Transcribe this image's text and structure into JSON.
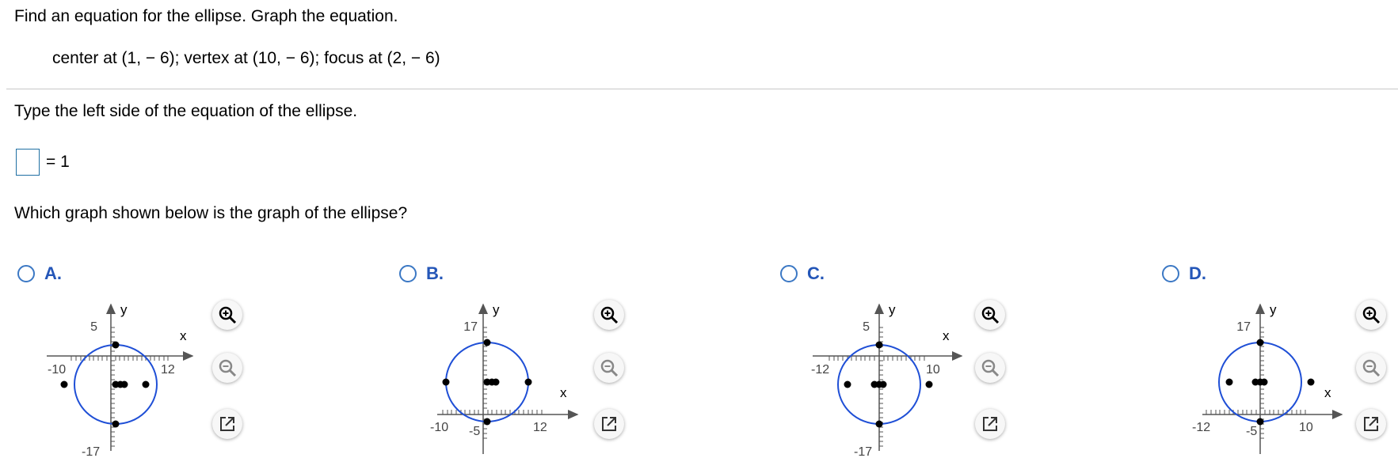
{
  "problem": {
    "prompt": "Find an equation for the ellipse.  Graph the equation.",
    "given": "center at (1, − 6);  vertex at (10, − 6);  focus at (2, − 6)",
    "instruction": "Type the left side of the equation of the ellipse.",
    "answer_value": "",
    "equals_text": "= 1",
    "graph_question": "Which graph shown below is the graph of the ellipse?"
  },
  "options": [
    {
      "letter": "A.",
      "xlabel": "x",
      "ylabel": "y",
      "tick_x_left": "-10",
      "tick_x_right": "12",
      "tick_y_top": "5",
      "tick_y_bottom": "-17"
    },
    {
      "letter": "B.",
      "xlabel": "x",
      "ylabel": "y",
      "tick_x_left": "-10",
      "tick_x_right": "12",
      "tick_y_top": "17",
      "tick_y_bottom": "-5"
    },
    {
      "letter": "C.",
      "xlabel": "x",
      "ylabel": "y",
      "tick_x_left": "-12",
      "tick_x_right": "10",
      "tick_y_top": "5",
      "tick_y_bottom": "-17"
    },
    {
      "letter": "D.",
      "xlabel": "x",
      "ylabel": "y",
      "tick_x_left": "-12",
      "tick_x_right": "10",
      "tick_y_top": "17",
      "tick_y_bottom": "-5"
    }
  ],
  "icons": {
    "zoom_in": "zoom-in-icon",
    "zoom_out": "zoom-out-icon",
    "popout": "popout-icon"
  },
  "colors": {
    "curve": "#1f4fd6",
    "option_letter": "#2456b8",
    "radio": "#3b78c4",
    "answer_box": "#1f6fa3"
  }
}
